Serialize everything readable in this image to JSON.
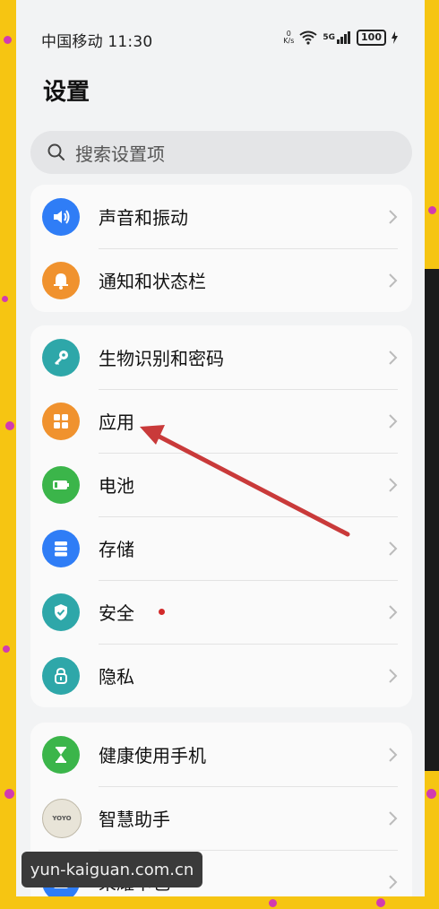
{
  "status_bar": {
    "carrier_time": "中国移动 11:30",
    "speed_value": "0",
    "speed_unit": "K/s",
    "network": "5G",
    "battery": "100"
  },
  "page_title": "设置",
  "search": {
    "placeholder": "搜索设置项"
  },
  "groups": [
    {
      "items": [
        {
          "label": "声音和振动",
          "icon": "volume-icon",
          "color": "#2f7df6"
        },
        {
          "label": "通知和状态栏",
          "icon": "bell-icon",
          "color": "#f0922e"
        }
      ]
    },
    {
      "items": [
        {
          "label": "生物识别和密码",
          "icon": "key-icon",
          "color": "#2ea7a9"
        },
        {
          "label": "应用",
          "icon": "apps-grid-icon",
          "color": "#f0922e"
        },
        {
          "label": "电池",
          "icon": "battery-icon",
          "color": "#3bb54a"
        },
        {
          "label": "存储",
          "icon": "storage-icon",
          "color": "#2f7df6"
        },
        {
          "label": "安全",
          "icon": "shield-check-icon",
          "color": "#2ea7a9",
          "badge": "red-dot"
        },
        {
          "label": "隐私",
          "icon": "privacy-lock-icon",
          "color": "#2ea7a9"
        }
      ]
    },
    {
      "items": [
        {
          "label": "健康使用手机",
          "icon": "hourglass-icon",
          "color": "#3bb54a"
        },
        {
          "label": "智慧助手",
          "icon": "yoyo-icon",
          "color": "#d9d4c4"
        },
        {
          "label": "荣耀卡包",
          "icon": "wallet-icon",
          "color": "#2f7df6"
        }
      ]
    }
  ],
  "watermark": "yun-kaiguan.com.cn",
  "annotation": {
    "type": "arrow",
    "color": "#c93a3a",
    "target": "应用"
  }
}
